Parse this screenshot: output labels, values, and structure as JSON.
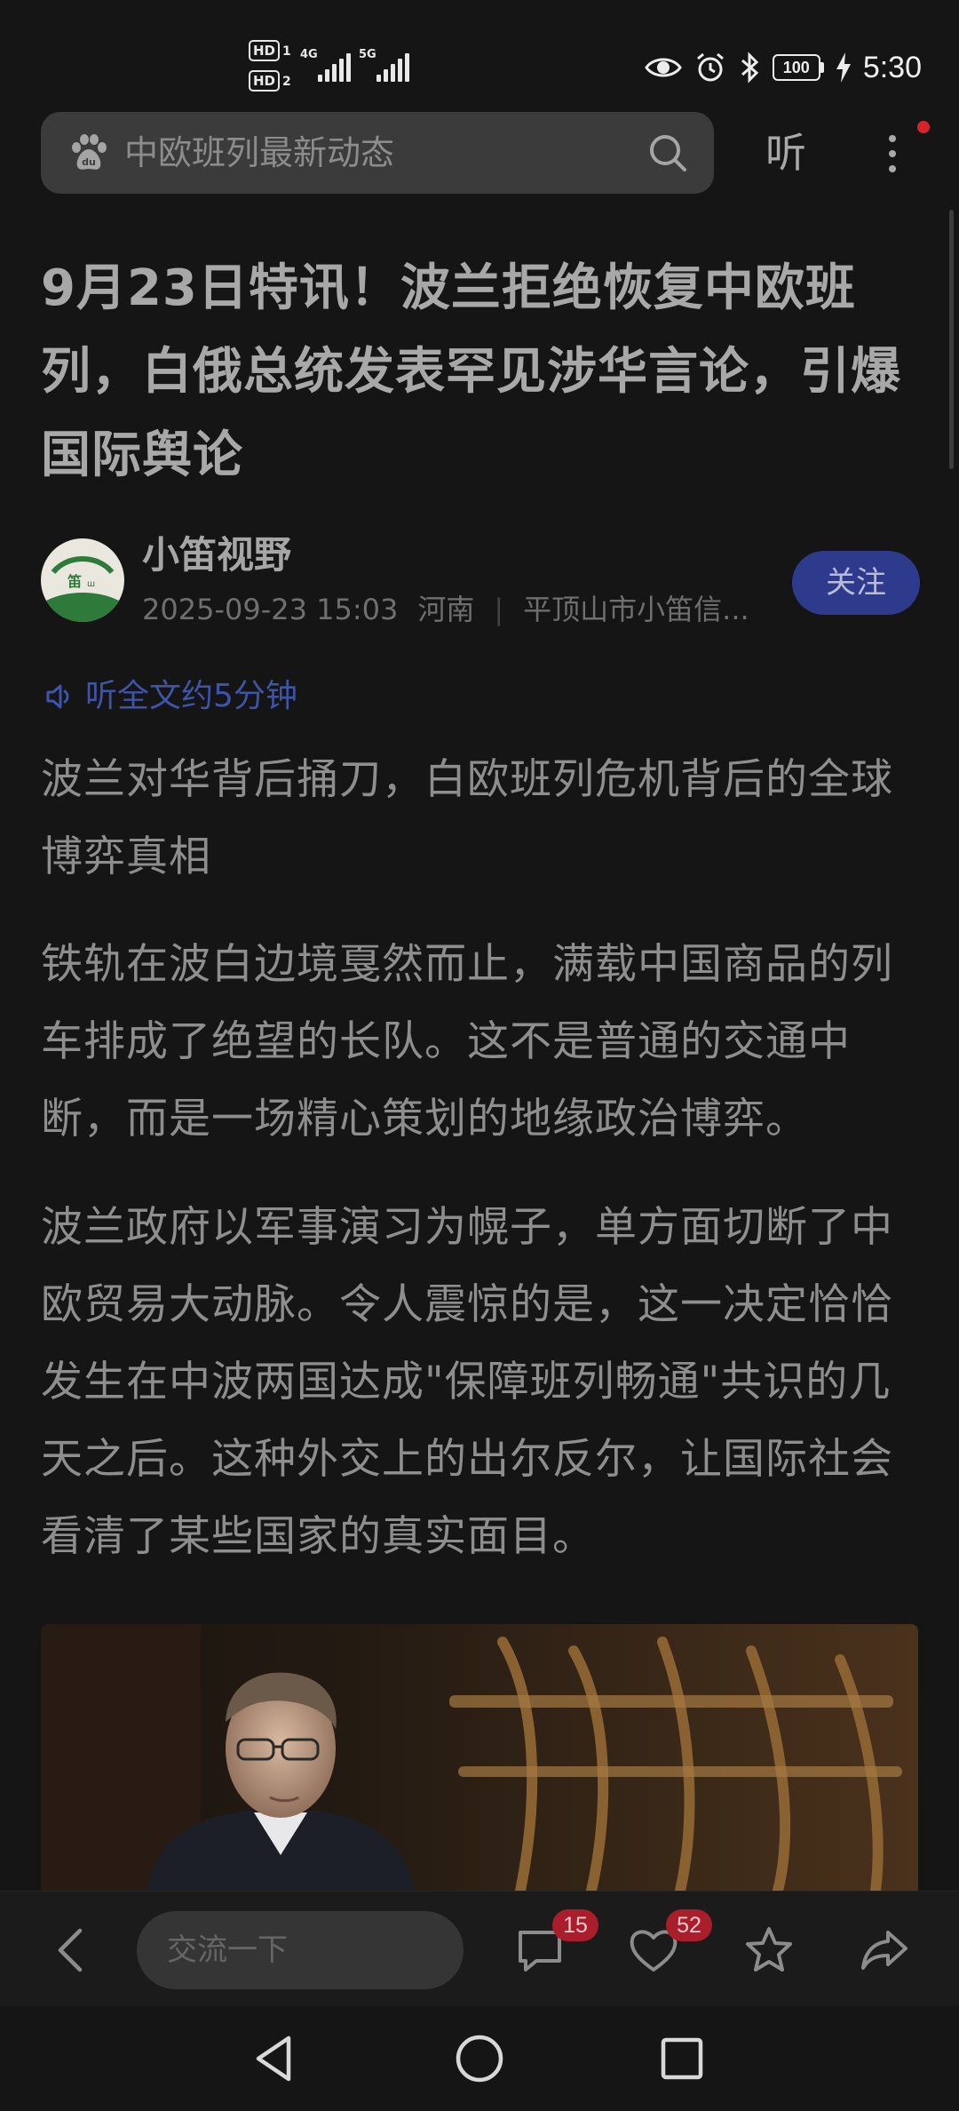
{
  "status_bar": {
    "hd1": "HD",
    "hd1_sub": "1",
    "hd2": "HD",
    "hd2_sub": "2",
    "net1": "4G",
    "net2": "5G",
    "battery": "100",
    "time": "5:30"
  },
  "header": {
    "search_placeholder": "中欧班列最新动态",
    "listen_label": "听"
  },
  "article": {
    "title": "9月23日特讯！波兰拒绝恢复中欧班列，白俄总统发表罕见涉华言论，引爆国际舆论",
    "author_name": "小笛视野",
    "publish_time": "2025-09-23 15:03",
    "location": "河南",
    "source": "平顶山市小笛信...",
    "follow_label": "关注",
    "listen_all": "听全文约5分钟",
    "paragraphs": [
      "波兰对华背后捅刀，白欧班列危机背后的全球博弈真相",
      "铁轨在波白边境戛然而止，满载中国商品的列车排成了绝望的长队。这不是普通的交通中断，而是一场精心策划的地缘政治博弈。",
      "波兰政府以军事演习为幌子，单方面切断了中欧贸易大动脉。令人震惊的是，这一决定恰恰发生在中波两国达成\"保障班列畅通\"共识的几天之后。这种外交上的出尔反尔，让国际社会看清了某些国家的真实面目。"
    ]
  },
  "bottom_bar": {
    "comment_placeholder": "交流一下",
    "comment_count": "15",
    "like_count": "52"
  },
  "colors": {
    "background": "#151515",
    "follow_button": "#2e3a8c",
    "link_blue": "#3e54a8",
    "badge_red": "#a91e2a"
  }
}
